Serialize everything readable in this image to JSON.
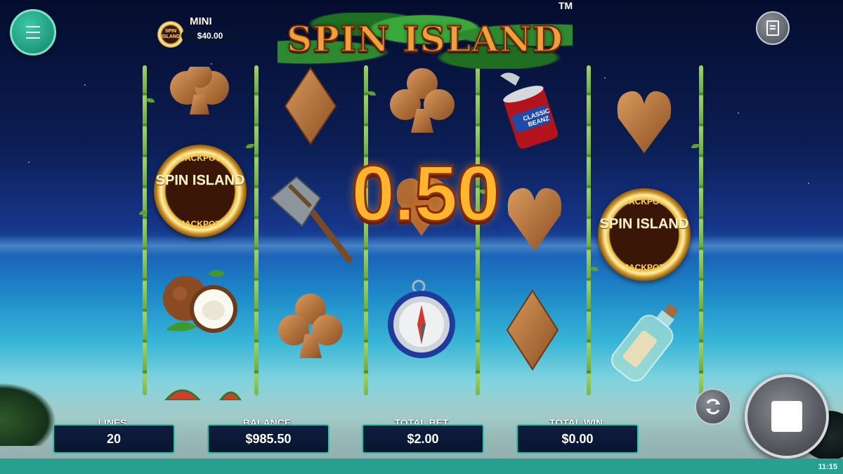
{
  "game": {
    "logo": "SPIN ISLAND",
    "trademark": "TM",
    "jackpot_coin_top": "JACKPOT",
    "jackpot_coin_mid": "SPIN ISLAND",
    "jackpot_coin_bottom": "JACKPOT",
    "can_label": "CLASSIC BEANZ"
  },
  "jackpot": {
    "tier": "MINI",
    "value": "$40.00",
    "coin_text": "SPIN ISLAND"
  },
  "reels": [
    [
      "club",
      "jackpot-coin",
      "coconut"
    ],
    [
      "diamond",
      "stone-axe",
      "club"
    ],
    [
      "club",
      "heart",
      "compass"
    ],
    [
      "bean-can",
      "heart",
      "diamond"
    ],
    [
      "heart",
      "jackpot-coin",
      "message-bottle"
    ]
  ],
  "win_display": "0.50",
  "stats": {
    "lines_label": "LINES",
    "lines_value": "20",
    "balance_label": "BALANCE",
    "balance_value": "$985.50",
    "bet_label": "TOTAL BET",
    "bet_value": "$2.00",
    "win_label": "TOTAL WIN",
    "win_value": "$0.00"
  },
  "clock": "11:15",
  "colors": {
    "accent": "#24c8a2",
    "win_text": "#ffb52e",
    "footer": "#27a090"
  }
}
